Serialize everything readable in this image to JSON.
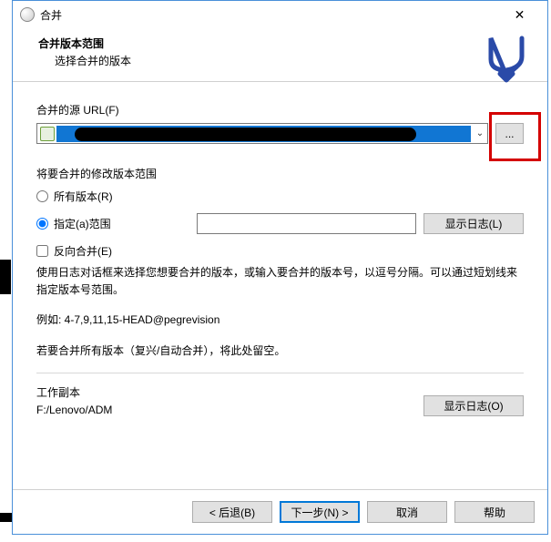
{
  "titlebar": {
    "title": "合并"
  },
  "header": {
    "title": "合并版本范围",
    "subtitle": "选择合并的版本"
  },
  "source": {
    "label": "合并的源 URL(F)",
    "browse_label": "..."
  },
  "revisions": {
    "section_title": "将要合并的修改版本范围",
    "all_label": "所有版本(R)",
    "specific_label": "指定(a)范围",
    "range_value": "",
    "log_label": "显示日志(L)",
    "reverse_label": "反向合并(E)",
    "help_line1": "使用日志对话框来选择您想要合并的版本，或输入要合并的版本号，以逗号分隔。可以通过短划线来指定版本号范围。",
    "help_line2": "例如: 4-7,9,11,15-HEAD@pegrevision",
    "help_line3": "若要合并所有版本（复兴/自动合并），将此处留空。"
  },
  "working_copy": {
    "label": "工作副本",
    "path": "F:/Lenovo/ADM",
    "log_label": "显示日志(O)"
  },
  "footer": {
    "back": "< 后退(B)",
    "next": "下一步(N) >",
    "cancel": "取消",
    "help": "帮助"
  }
}
